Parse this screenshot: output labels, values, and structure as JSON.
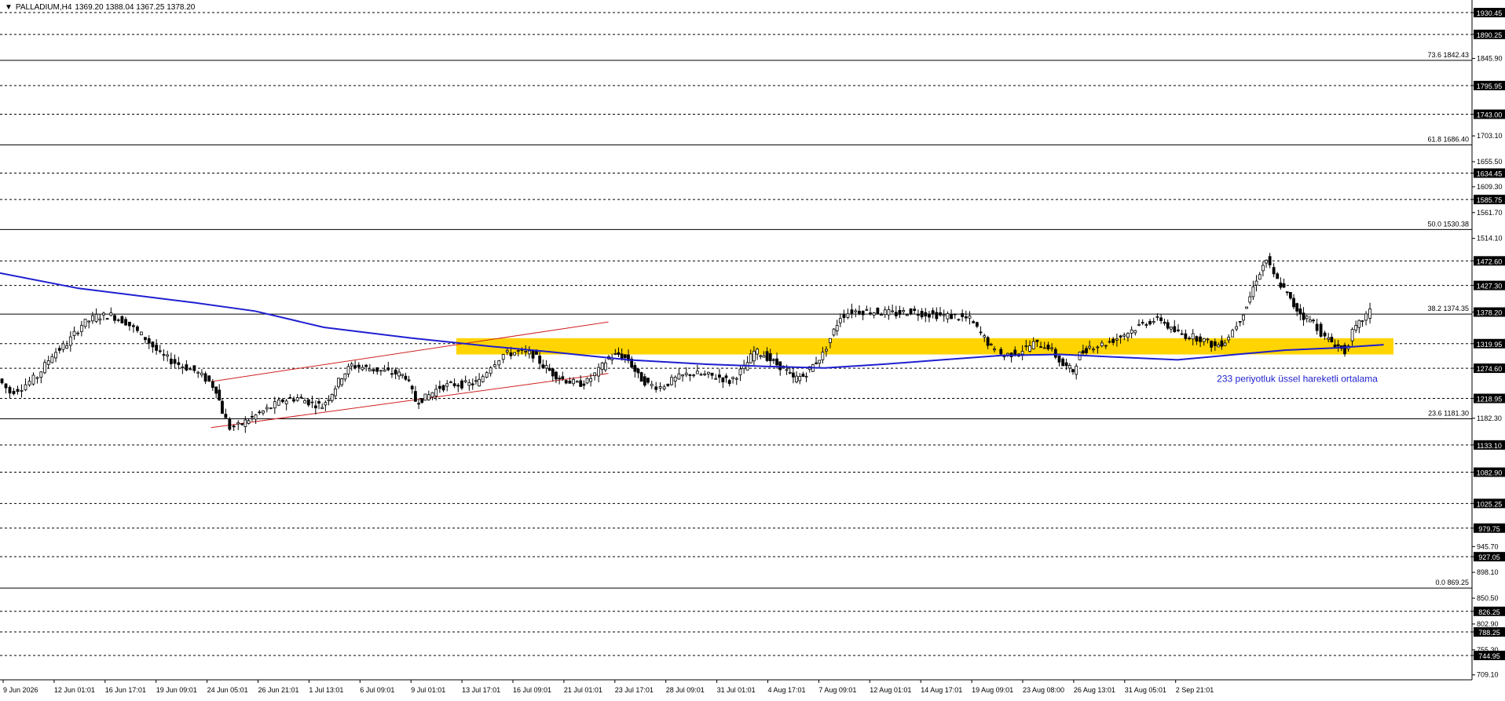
{
  "header": {
    "symbol": "PALLADIUM,H4",
    "ohlc": "1369.20 1388.04 1367.25 1378.20"
  },
  "annotation": "233 periyotluk üssel hareketli ortalama",
  "chart_data": {
    "type": "candlestick",
    "title": "",
    "ylim": [
      700,
      1945
    ],
    "price_ticks": [
      {
        "label": "1930.45",
        "value": 1930.45,
        "boxed": true
      },
      {
        "label": "1890.25",
        "value": 1890.25,
        "boxed": true
      },
      {
        "label": "1845.90",
        "value": 1845.9,
        "boxed": false
      },
      {
        "label": "1795.95",
        "value": 1795.95,
        "boxed": true
      },
      {
        "label": "1743.00",
        "value": 1743.0,
        "boxed": true
      },
      {
        "label": "1703.10",
        "value": 1703.1,
        "boxed": false
      },
      {
        "label": "1655.50",
        "value": 1655.5,
        "boxed": false
      },
      {
        "label": "1634.45",
        "value": 1634.45,
        "boxed": true
      },
      {
        "label": "1609.30",
        "value": 1609.3,
        "boxed": false
      },
      {
        "label": "1585.75",
        "value": 1585.75,
        "boxed": true
      },
      {
        "label": "1561.70",
        "value": 1561.7,
        "boxed": false
      },
      {
        "label": "1514.10",
        "value": 1514.1,
        "boxed": false
      },
      {
        "label": "1472.60",
        "value": 1472.6,
        "boxed": true
      },
      {
        "label": "1427.30",
        "value": 1427.3,
        "boxed": true
      },
      {
        "label": "1378.20",
        "value": 1378.2,
        "boxed": true,
        "current": true
      },
      {
        "label": "1319.95",
        "value": 1319.95,
        "boxed": true
      },
      {
        "label": "1274.60",
        "value": 1274.6,
        "boxed": true
      },
      {
        "label": "1218.95",
        "value": 1218.95,
        "boxed": true
      },
      {
        "label": "1182.30",
        "value": 1182.3,
        "boxed": false
      },
      {
        "label": "1133.10",
        "value": 1133.1,
        "boxed": true
      },
      {
        "label": "1082.90",
        "value": 1082.9,
        "boxed": true
      },
      {
        "label": "1025.25",
        "value": 1025.25,
        "boxed": true
      },
      {
        "label": "979.75",
        "value": 979.75,
        "boxed": true
      },
      {
        "label": "945.70",
        "value": 945.7,
        "boxed": false
      },
      {
        "label": "927.05",
        "value": 927.05,
        "boxed": true
      },
      {
        "label": "898.10",
        "value": 898.1,
        "boxed": false
      },
      {
        "label": "850.50",
        "value": 850.5,
        "boxed": false
      },
      {
        "label": "826.25",
        "value": 826.25,
        "boxed": true
      },
      {
        "label": "802.90",
        "value": 802.9,
        "boxed": false
      },
      {
        "label": "788.25",
        "value": 788.25,
        "boxed": true
      },
      {
        "label": "755.30",
        "value": 755.3,
        "boxed": false
      },
      {
        "label": "744.95",
        "value": 744.95,
        "boxed": true
      },
      {
        "label": "709.10",
        "value": 709.1,
        "boxed": false
      }
    ],
    "dashed_levels": [
      1930.45,
      1890.25,
      1795.95,
      1743.0,
      1634.45,
      1585.75,
      1472.6,
      1427.3,
      1319.95,
      1274.6,
      1218.95,
      1133.1,
      1082.9,
      1025.25,
      979.75,
      927.05,
      826.25,
      788.25,
      744.95
    ],
    "fib_levels": [
      {
        "label": "73.6 1842.43",
        "value": 1842.43
      },
      {
        "label": "61.8 1686.40",
        "value": 1686.4
      },
      {
        "label": "50.0 1530.38",
        "value": 1530.38
      },
      {
        "label": "38.2 1374.35",
        "value": 1374.35
      },
      {
        "label": "23.6 1181.30",
        "value": 1181.3
      },
      {
        "label": "0.0 869.25",
        "value": 869.25
      }
    ],
    "time_labels": [
      "9 Jun 2026",
      "12 Jun 01:01",
      "16 Jun 17:01",
      "19 Jun 09:01",
      "24 Jun 05:01",
      "26 Jun 21:01",
      "1 Jul 13:01",
      "6 Jul 09:01",
      "9 Jul 01:01",
      "13 Jul 17:01",
      "16 Jul 09:01",
      "21 Jul 01:01",
      "23 Jul 17:01",
      "28 Jul 09:01",
      "31 Jul 01:01",
      "4 Aug 17:01",
      "7 Aug 09:01",
      "12 Aug 01:01",
      "14 Aug 17:01",
      "19 Aug 09:01",
      "23 Aug 08:00",
      "26 Aug 13:01",
      "31 Aug 05:01",
      "2 Sep 21:01"
    ],
    "price_path": [
      [
        0,
        1255
      ],
      [
        12,
        1230
      ],
      [
        24,
        1240
      ],
      [
        40,
        1260
      ],
      [
        55,
        1300
      ],
      [
        70,
        1320
      ],
      [
        85,
        1355
      ],
      [
        100,
        1370
      ],
      [
        115,
        1372
      ],
      [
        130,
        1360
      ],
      [
        150,
        1330
      ],
      [
        165,
        1300
      ],
      [
        180,
        1285
      ],
      [
        200,
        1270
      ],
      [
        215,
        1250
      ],
      [
        222,
        1235
      ],
      [
        228,
        1195
      ],
      [
        236,
        1165
      ],
      [
        245,
        1168
      ],
      [
        255,
        1180
      ],
      [
        270,
        1195
      ],
      [
        290,
        1215
      ],
      [
        305,
        1220
      ],
      [
        320,
        1210
      ],
      [
        330,
        1205
      ],
      [
        340,
        1230
      ],
      [
        350,
        1260
      ],
      [
        360,
        1280
      ],
      [
        375,
        1275
      ],
      [
        390,
        1270
      ],
      [
        405,
        1265
      ],
      [
        415,
        1260
      ],
      [
        425,
        1215
      ],
      [
        435,
        1220
      ],
      [
        450,
        1240
      ],
      [
        465,
        1245
      ],
      [
        480,
        1245
      ],
      [
        490,
        1250
      ],
      [
        502,
        1280
      ],
      [
        515,
        1300
      ],
      [
        530,
        1305
      ],
      [
        545,
        1300
      ],
      [
        555,
        1280
      ],
      [
        565,
        1265
      ],
      [
        575,
        1255
      ],
      [
        590,
        1245
      ],
      [
        600,
        1250
      ],
      [
        612,
        1270
      ],
      [
        622,
        1295
      ],
      [
        632,
        1300
      ],
      [
        642,
        1290
      ],
      [
        652,
        1260
      ],
      [
        662,
        1245
      ],
      [
        675,
        1240
      ],
      [
        690,
        1255
      ],
      [
        705,
        1265
      ],
      [
        720,
        1262
      ],
      [
        735,
        1258
      ],
      [
        745,
        1250
      ],
      [
        760,
        1275
      ],
      [
        770,
        1305
      ],
      [
        780,
        1300
      ],
      [
        790,
        1285
      ],
      [
        800,
        1275
      ],
      [
        810,
        1255
      ],
      [
        820,
        1260
      ],
      [
        830,
        1280
      ],
      [
        840,
        1300
      ],
      [
        848,
        1330
      ],
      [
        858,
        1370
      ],
      [
        870,
        1380
      ],
      [
        885,
        1380
      ],
      [
        900,
        1378
      ],
      [
        915,
        1375
      ],
      [
        930,
        1380
      ],
      [
        945,
        1375
      ],
      [
        960,
        1372
      ],
      [
        975,
        1370
      ],
      [
        990,
        1365
      ],
      [
        1005,
        1330
      ],
      [
        1015,
        1305
      ],
      [
        1025,
        1298
      ],
      [
        1040,
        1305
      ],
      [
        1055,
        1320
      ],
      [
        1070,
        1315
      ],
      [
        1085,
        1280
      ],
      [
        1095,
        1270
      ],
      [
        1102,
        1300
      ],
      [
        1112,
        1315
      ],
      [
        1125,
        1318
      ],
      [
        1140,
        1330
      ],
      [
        1155,
        1345
      ],
      [
        1170,
        1360
      ],
      [
        1185,
        1365
      ],
      [
        1195,
        1345
      ],
      [
        1210,
        1335
      ],
      [
        1225,
        1330
      ],
      [
        1240,
        1315
      ],
      [
        1250,
        1325
      ],
      [
        1262,
        1355
      ],
      [
        1272,
        1390
      ],
      [
        1282,
        1440
      ],
      [
        1292,
        1475
      ],
      [
        1300,
        1445
      ],
      [
        1310,
        1420
      ],
      [
        1320,
        1390
      ],
      [
        1330,
        1370
      ],
      [
        1340,
        1360
      ],
      [
        1352,
        1330
      ],
      [
        1362,
        1320
      ],
      [
        1372,
        1305
      ],
      [
        1380,
        1340
      ],
      [
        1390,
        1365
      ],
      [
        1398,
        1378
      ]
    ],
    "ema_233": [
      [
        0,
        1450
      ],
      [
        80,
        1422
      ],
      [
        200,
        1395
      ],
      [
        260,
        1380
      ],
      [
        330,
        1350
      ],
      [
        420,
        1330
      ],
      [
        500,
        1315
      ],
      [
        560,
        1305
      ],
      [
        640,
        1290
      ],
      [
        720,
        1282
      ],
      [
        780,
        1278
      ],
      [
        840,
        1275
      ],
      [
        900,
        1282
      ],
      [
        960,
        1290
      ],
      [
        1020,
        1298
      ],
      [
        1080,
        1300
      ],
      [
        1140,
        1295
      ],
      [
        1200,
        1290
      ],
      [
        1260,
        1300
      ],
      [
        1310,
        1308
      ],
      [
        1360,
        1312
      ],
      [
        1410,
        1318
      ]
    ],
    "channel_lines": [
      {
        "from": [
          215,
          1250
        ],
        "to": [
          620,
          1360
        ]
      },
      {
        "from": [
          215,
          1165
        ],
        "to": [
          620,
          1265
        ]
      }
    ],
    "zone": {
      "top": 1330,
      "bottom": 1300,
      "x_start": 465,
      "x_end": 1420
    }
  }
}
